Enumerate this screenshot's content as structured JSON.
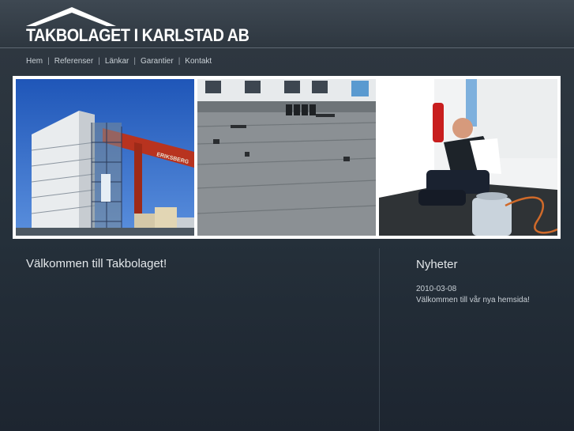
{
  "site": {
    "logo_text": "TAKBOLAGET I KARLSTAD AB"
  },
  "nav": {
    "items": [
      "Hem",
      "Referenser",
      "Länkar",
      "Garantier",
      "Kontakt"
    ],
    "separator": "|"
  },
  "gallery": {
    "photos": [
      {
        "name": "highrise-construction-photo"
      },
      {
        "name": "flat-roof-photo"
      },
      {
        "name": "roofer-working-photo"
      }
    ],
    "crane_sign": "ERIKSBERG"
  },
  "main": {
    "heading": "Välkommen till Takbolaget!"
  },
  "news": {
    "heading": "Nyheter",
    "items": [
      {
        "date": "2010-03-08",
        "text": "Välkommen till vår nya hemsida!"
      }
    ]
  },
  "colors": {
    "background": "#25303a",
    "text": "#cfd6dc",
    "frame": "#ffffff"
  }
}
